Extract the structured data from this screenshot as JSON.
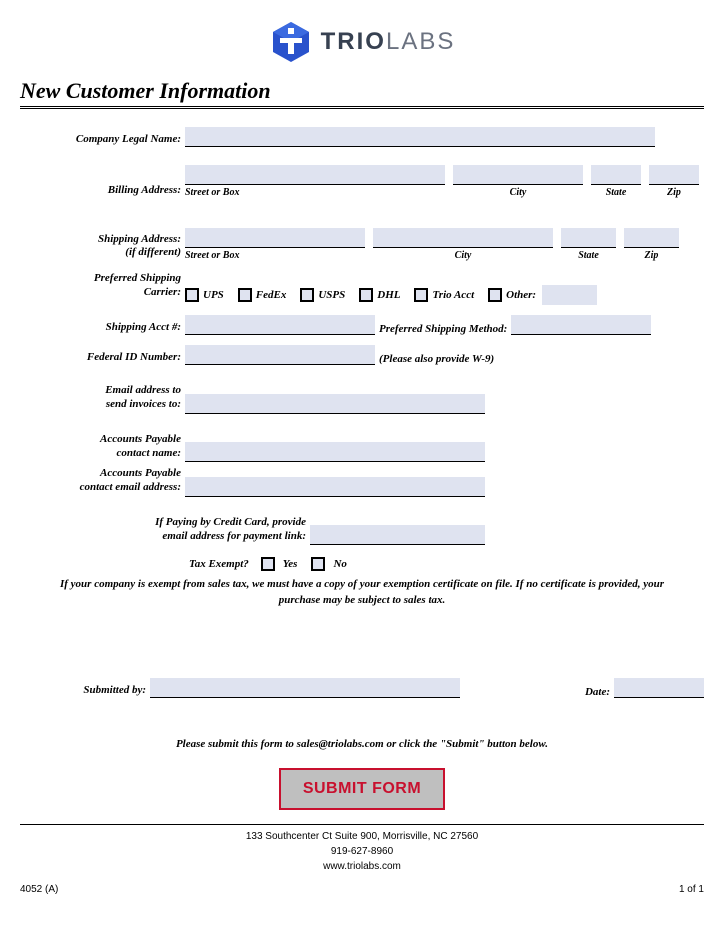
{
  "logo": {
    "bold": "TRIO",
    "light": "LABS"
  },
  "title": "New Customer Information",
  "labels": {
    "company": "Company Legal Name:",
    "billing": "Billing Address:",
    "shipping": "Shipping Address:",
    "shippingNote": "(if different)",
    "street": "Street or Box",
    "city": "City",
    "state": "State",
    "zip": "Zip",
    "carrier1": "Preferred Shipping",
    "carrier2": "Carrier:",
    "ups": "UPS",
    "fedex": "FedEx",
    "usps": "USPS",
    "dhl": "DHL",
    "trio": "Trio Acct",
    "other": "Other:",
    "shipAcct": "Shipping Acct #:",
    "shipMethod": "Preferred Shipping Method:",
    "fedId": "Federal ID Number:",
    "w9": "(Please also provide W-9)",
    "email1a": "Email address to",
    "email1b": "send invoices to:",
    "ap1a": "Accounts Payable",
    "ap1b": "contact name:",
    "ap2a": "Accounts Payable",
    "ap2b": "contact email address:",
    "cc1": "If Paying by Credit Card, provide",
    "cc2": "email address for payment link:",
    "taxExempt": "Tax Exempt?",
    "yes": "Yes",
    "no": "No",
    "taxNote": "If your company is exempt from sales tax, we must have a copy of your exemption certificate on file.  If no certificate is provided, your purchase may be subject to sales tax.",
    "submittedBy": "Submitted by:",
    "date": "Date:",
    "submitInstr": "Please submit this form to sales@triolabs.com or click the \"Submit\" button below.",
    "submitBtn": "SUBMIT FORM"
  },
  "footer": {
    "addr": "133 Southcenter Ct Suite 900, Morrisville, NC 27560",
    "phone": "919-627-8960",
    "web": "www.triolabs.com",
    "docId": "4052 (A)",
    "page": "1 of 1"
  }
}
